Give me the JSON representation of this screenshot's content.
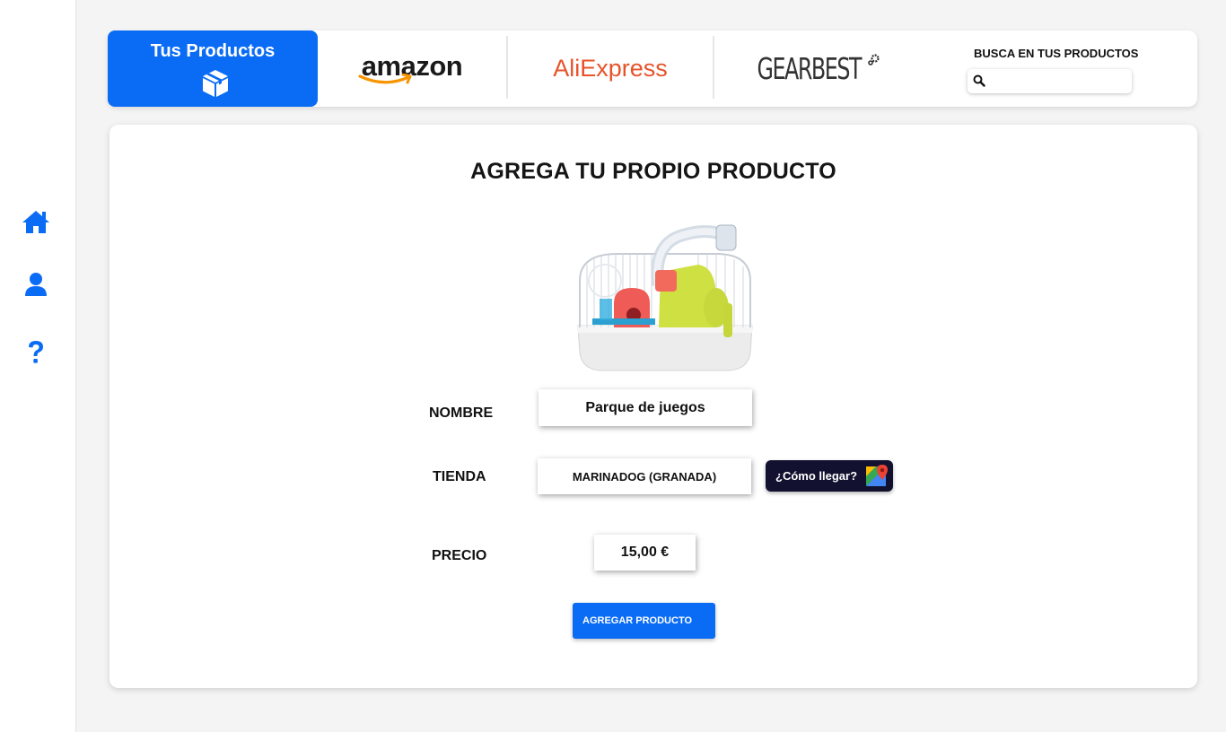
{
  "sidebar": {
    "items": [
      {
        "name": "home",
        "icon": "home-icon"
      },
      {
        "name": "profile",
        "icon": "user-icon"
      },
      {
        "name": "help",
        "icon": "question-icon"
      }
    ],
    "icon_color": "#0a6cf5"
  },
  "topbar": {
    "your_products_tab": {
      "label": "Tus Productos",
      "icon": "box-icon"
    },
    "stores": [
      {
        "name": "amazon",
        "logo_text": "amazon"
      },
      {
        "name": "aliexpress",
        "logo_text_1": "Ali",
        "logo_text_2": "Express"
      },
      {
        "name": "gearbest",
        "logo_text": "GEARBEST"
      }
    ],
    "search": {
      "label": "BUSCA EN TUS PRODUCTOS",
      "value": "",
      "placeholder": ""
    }
  },
  "form": {
    "title": "AGREGA TU PROPIO PRODUCTO",
    "image": "hamster-cage-product-image",
    "name_label": "NOMBRE",
    "name_value": "Parque de juegos",
    "store_label": "TIENDA",
    "store_value": "MARINADOG (GRANADA)",
    "directions_button": "¿Cómo llegar?",
    "price_label": "PRECIO",
    "price_value": "15,00 €",
    "submit_button": "AGREGAR PRODUCTO"
  },
  "colors": {
    "accent": "#0a6cf5",
    "dark_button": "#121230",
    "background": "#f4f4f4"
  }
}
